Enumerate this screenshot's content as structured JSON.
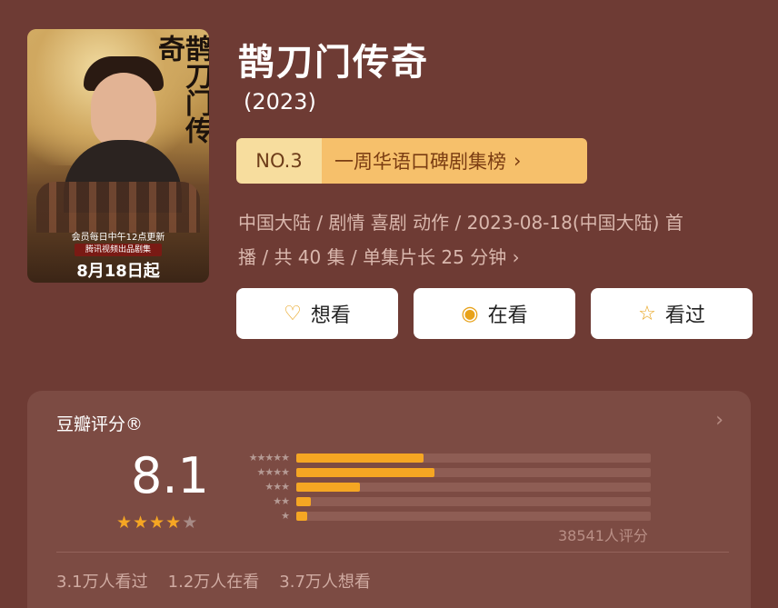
{
  "poster": {
    "brush_title": "鹊刀门传奇",
    "caption_update": "会员每日中午12点更新",
    "caption_platform": "腾讯视频出品剧集",
    "caption_date": "8月18日起"
  },
  "title": "鹊刀门传奇",
  "year": "(2023)",
  "rank": {
    "no": "NO.3",
    "name": "一周华语口碑剧集榜",
    "chevron": "›"
  },
  "meta": {
    "line1": "中国大陆 / 剧情 喜剧 动作 / 2023-08-18(中国大陆) 首",
    "line2": "播 / 共 40 集 / 单集片长 25 分钟 ›"
  },
  "actions": {
    "want": {
      "label": "想看",
      "icon": "heart-plus-icon",
      "glyph": "♡"
    },
    "watching": {
      "label": "在看",
      "icon": "target-icon",
      "glyph": "◉"
    },
    "watched": {
      "label": "看过",
      "icon": "star-outline-icon",
      "glyph": "☆"
    }
  },
  "rating": {
    "title": "豆瓣评分®",
    "chevron": "›",
    "score": "8.1",
    "stars_filled": 4,
    "stars_total": 5,
    "star_glyph": "★",
    "distribution": [
      {
        "label": "★★★★★",
        "fraction": 0.36
      },
      {
        "label": "★★★★",
        "fraction": 0.39
      },
      {
        "label": "★★★",
        "fraction": 0.18
      },
      {
        "label": "★★",
        "fraction": 0.04
      },
      {
        "label": "★",
        "fraction": 0.03
      }
    ],
    "count": "38541人评分",
    "stats": [
      "3.1万人看过",
      "1.2万人在看",
      "3.7万人想看"
    ]
  },
  "colors": {
    "background": "#6e3b34",
    "accent": "#f5a623"
  }
}
